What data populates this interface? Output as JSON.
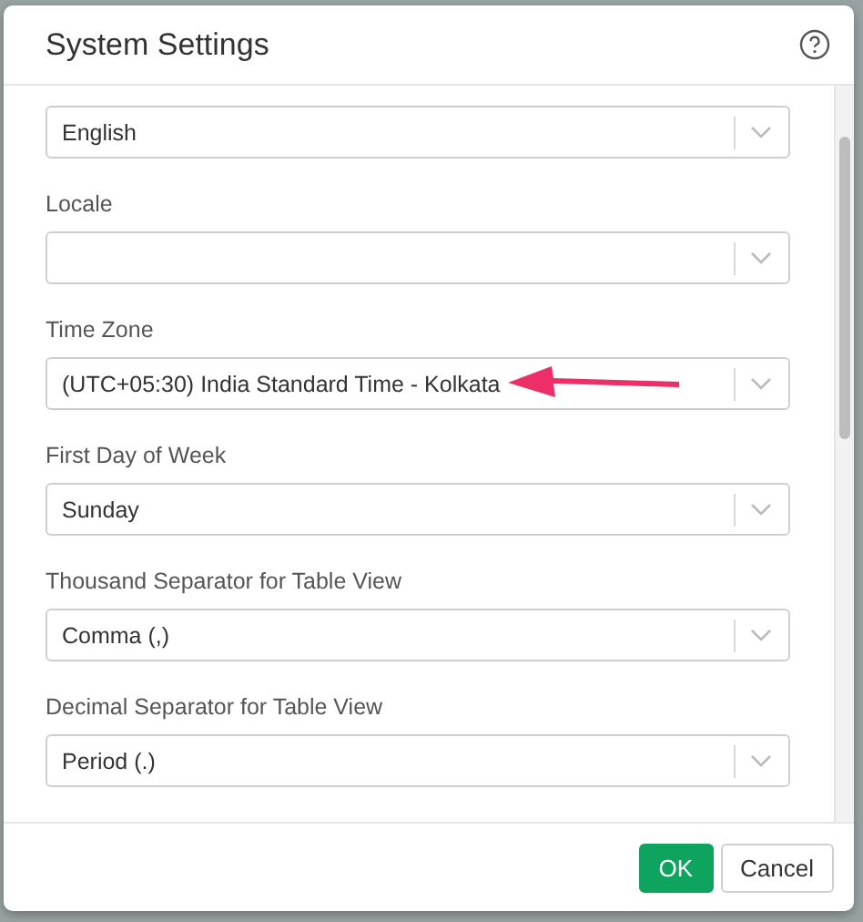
{
  "dialog": {
    "title": "System Settings"
  },
  "fields": [
    {
      "value": "English",
      "annotated": false
    },
    {
      "label": "Locale",
      "annotated": false
    },
    {
      "label": "Time Zone",
      "value": "(UTC+05:30) India Standard Time - Kolkata",
      "annotated": true
    },
    {
      "label": "First Day of Week",
      "value": "Sunday",
      "annotated": false
    },
    {
      "label": "Thousand Separator for Table View",
      "value": "Comma (,)",
      "annotated": false
    },
    {
      "label": "Decimal Separator for Table View",
      "value": "Period (.)",
      "annotated": false
    }
  ],
  "buttons": [
    {
      "label": "OK",
      "kind": "primary"
    },
    {
      "label": "Cancel",
      "kind": "default"
    }
  ]
}
